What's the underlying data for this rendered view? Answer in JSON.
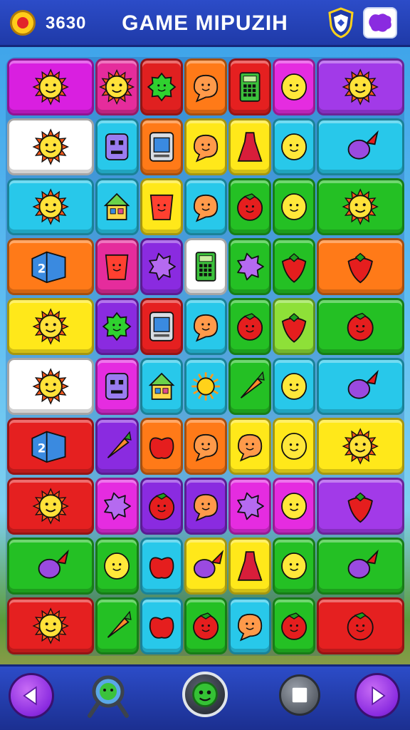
{
  "header": {
    "score": "3630",
    "title": "GAME MIPUZIH",
    "coin_icon": "tomato-coin-icon",
    "shield_icon": "shield-badge-icon",
    "map_icon": "purple-map-icon"
  },
  "board": {
    "rows": [
      [
        {
          "span": 2,
          "color": "#d91fe0",
          "icon": "sun-face"
        },
        {
          "span": 1,
          "color": "#e52c9c",
          "icon": "sun-face"
        },
        {
          "span": 1,
          "color": "#e02020",
          "icon": "virus-face"
        },
        {
          "span": 1,
          "color": "#ff7a18",
          "icon": "bubble-face"
        },
        {
          "span": 1,
          "color": "#e52020",
          "icon": "phone"
        },
        {
          "span": 1,
          "color": "#e52ce0",
          "icon": "lemon-face"
        },
        {
          "span": 2,
          "color": "#a23ae8",
          "icon": "sun-face"
        }
      ],
      [
        {
          "span": 2,
          "color": "#ffffff",
          "icon": "sun-face"
        },
        {
          "span": 1,
          "color": "#28c8ea",
          "icon": "robot-face"
        },
        {
          "span": 1,
          "color": "#ff7a18",
          "icon": "device"
        },
        {
          "span": 1,
          "color": "#ffe81a",
          "icon": "bubble-face"
        },
        {
          "span": 1,
          "color": "#ffe81a",
          "icon": "dress"
        },
        {
          "span": 1,
          "color": "#28c8ea",
          "icon": "lemon-face"
        },
        {
          "span": 2,
          "color": "#28c8ea",
          "icon": "turnip"
        }
      ],
      [
        {
          "span": 2,
          "color": "#28c8ea",
          "icon": "sun-face"
        },
        {
          "span": 1,
          "color": "#28c8ea",
          "icon": "house"
        },
        {
          "span": 1,
          "color": "#ffe81a",
          "icon": "bucket-face"
        },
        {
          "span": 1,
          "color": "#28c8ea",
          "icon": "bubble-face"
        },
        {
          "span": 1,
          "color": "#24c024",
          "icon": "tomato-face"
        },
        {
          "span": 1,
          "color": "#24c024",
          "icon": "lemon-face"
        },
        {
          "span": 2,
          "color": "#24c024",
          "icon": "sun-face"
        }
      ],
      [
        {
          "span": 2,
          "color": "#ff7a18",
          "icon": "book"
        },
        {
          "span": 1,
          "color": "#e52c9c",
          "icon": "bucket-face"
        },
        {
          "span": 1,
          "color": "#8a2be0",
          "icon": "splat"
        },
        {
          "span": 1,
          "color": "#ffffff",
          "icon": "phone"
        },
        {
          "span": 1,
          "color": "#24c024",
          "icon": "splat"
        },
        {
          "span": 1,
          "color": "#24c024",
          "icon": "strawberry"
        },
        {
          "span": 2,
          "color": "#ff7a18",
          "icon": "strawberry"
        }
      ],
      [
        {
          "span": 2,
          "color": "#ffe81a",
          "icon": "sun-face"
        },
        {
          "span": 1,
          "color": "#8a2be0",
          "icon": "virus-face"
        },
        {
          "span": 1,
          "color": "#e52020",
          "icon": "device"
        },
        {
          "span": 1,
          "color": "#28c8ea",
          "icon": "bubble-face"
        },
        {
          "span": 1,
          "color": "#24c024",
          "icon": "tomato-face"
        },
        {
          "span": 1,
          "color": "#8ee038",
          "icon": "strawberry"
        },
        {
          "span": 2,
          "color": "#24c024",
          "icon": "tomato-face"
        }
      ],
      [
        {
          "span": 2,
          "color": "#ffffff",
          "icon": "sun-face"
        },
        {
          "span": 1,
          "color": "#e52ce0",
          "icon": "robot-face"
        },
        {
          "span": 1,
          "color": "#28c8ea",
          "icon": "house"
        },
        {
          "span": 1,
          "color": "#28c8ea",
          "icon": "sun"
        },
        {
          "span": 1,
          "color": "#24c024",
          "icon": "carrot"
        },
        {
          "span": 1,
          "color": "#28c8ea",
          "icon": "lemon-face"
        },
        {
          "span": 2,
          "color": "#28c8ea",
          "icon": "turnip"
        }
      ],
      [
        {
          "span": 2,
          "color": "#e52020",
          "icon": "book"
        },
        {
          "span": 1,
          "color": "#8a2be0",
          "icon": "carrot"
        },
        {
          "span": 1,
          "color": "#ff7a18",
          "icon": "apple"
        },
        {
          "span": 1,
          "color": "#ff7a18",
          "icon": "bubble-face"
        },
        {
          "span": 1,
          "color": "#ffe81a",
          "icon": "bubble-face"
        },
        {
          "span": 1,
          "color": "#ffe81a",
          "icon": "lemon-face"
        },
        {
          "span": 2,
          "color": "#ffe81a",
          "icon": "sun-face"
        }
      ],
      [
        {
          "span": 2,
          "color": "#e52020",
          "icon": "sun-face"
        },
        {
          "span": 1,
          "color": "#e52ce0",
          "icon": "splat"
        },
        {
          "span": 1,
          "color": "#8a2be0",
          "icon": "tomato-face"
        },
        {
          "span": 1,
          "color": "#8a2be0",
          "icon": "bubble-face"
        },
        {
          "span": 1,
          "color": "#e52ce0",
          "icon": "splat"
        },
        {
          "span": 1,
          "color": "#e52ce0",
          "icon": "lemon-face"
        },
        {
          "span": 2,
          "color": "#a23ae8",
          "icon": "strawberry"
        }
      ],
      [
        {
          "span": 2,
          "color": "#24c024",
          "icon": "turnip"
        },
        {
          "span": 1,
          "color": "#24c024",
          "icon": "lemon-face"
        },
        {
          "span": 1,
          "color": "#28c8ea",
          "icon": "apple"
        },
        {
          "span": 1,
          "color": "#ffe81a",
          "icon": "turnip"
        },
        {
          "span": 1,
          "color": "#ffe81a",
          "icon": "dress"
        },
        {
          "span": 1,
          "color": "#24c024",
          "icon": "lemon-face"
        },
        {
          "span": 2,
          "color": "#24c024",
          "icon": "turnip"
        }
      ],
      [
        {
          "span": 2,
          "color": "#e52020",
          "icon": "sun-face"
        },
        {
          "span": 1,
          "color": "#24c024",
          "icon": "carrot"
        },
        {
          "span": 1,
          "color": "#28c8ea",
          "icon": "apple"
        },
        {
          "span": 1,
          "color": "#24c024",
          "icon": "tomato-face"
        },
        {
          "span": 1,
          "color": "#28c8ea",
          "icon": "bubble-face"
        },
        {
          "span": 1,
          "color": "#24c024",
          "icon": "tomato-face"
        },
        {
          "span": 2,
          "color": "#e52020",
          "icon": "tomato-face"
        }
      ]
    ]
  },
  "footer": {
    "buttons": [
      {
        "name": "prev-arrow-button",
        "icon": "left-arrow-icon"
      },
      {
        "name": "magnifier-hint-button",
        "icon": "magnifier-icon"
      },
      {
        "name": "green-face-button",
        "icon": "green-face-icon"
      },
      {
        "name": "stop-button",
        "icon": "stop-square-icon"
      },
      {
        "name": "next-arrow-button",
        "icon": "right-arrow-icon"
      }
    ]
  }
}
